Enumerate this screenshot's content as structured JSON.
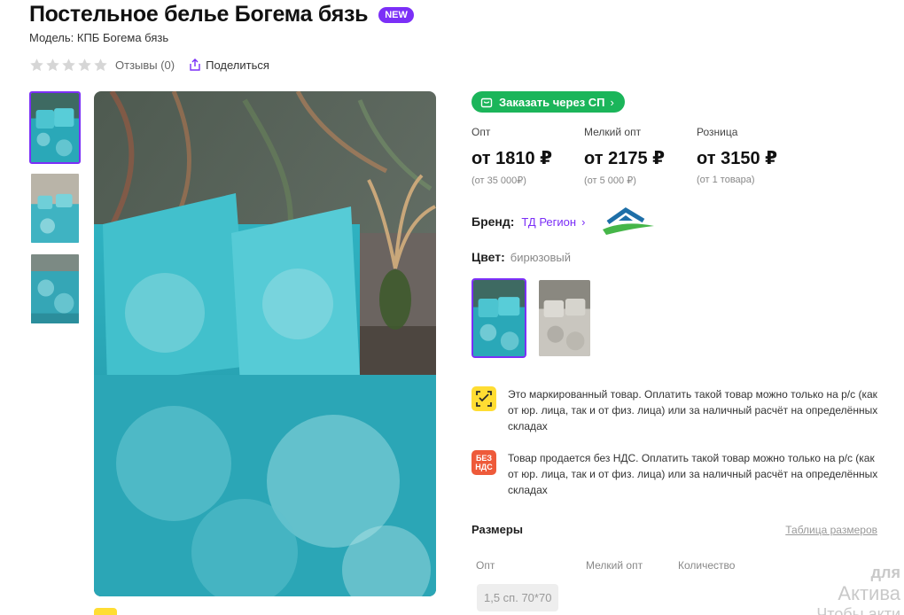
{
  "product": {
    "title": "Постельное белье Богема бязь",
    "badge": "NEW",
    "model": "Модель: КПБ Богема бязь",
    "reviews": "Отзывы (0)",
    "share": "Поделиться",
    "rating_stars": 0
  },
  "order_sp": {
    "label": "Заказать через СП",
    "chevron": "›"
  },
  "prices": [
    {
      "label": "Опт",
      "value": "от 1810 ₽",
      "min": "(от 35 000₽)"
    },
    {
      "label": "Мелкий опт",
      "value": "от 2175 ₽",
      "min": "(от 5 000 ₽)"
    },
    {
      "label": "Розница",
      "value": "от 3150 ₽",
      "min": "(от 1 товара)"
    }
  ],
  "brand": {
    "label": "Бренд:",
    "name": "ТД Регион",
    "chevron": "›"
  },
  "color": {
    "label": "Цвет:",
    "value": "бирюзовый"
  },
  "notices": [
    {
      "icon": "marking-icon",
      "text": "Это маркированный товар. Оплатить такой товар можно только на р/с (как от юр. лица, так и от физ. лица) или за наличный расчёт на определённых складах"
    },
    {
      "icon": "no-vat-icon",
      "icon_text": "БЕЗ НДС",
      "text": "Товар продается без НДС. Оплатить такой товар можно только на р/с (как от юр. лица, так и от физ. лица) или за наличный расчёт на определённых складах"
    }
  ],
  "sizes": {
    "title": "Размеры",
    "table_link": "Таблица размеров",
    "columns": [
      "Опт",
      "Мелкий опт",
      "Количество"
    ],
    "items": [
      "1,5 сп. 70*70"
    ]
  },
  "watermark": {
    "line1": "для",
    "line2": "Актива",
    "line3": "Чтобы акти"
  },
  "colors": {
    "accent": "#7b2ff7",
    "green": "#1bb55a",
    "marking_bg": "#ffdd33",
    "novat_bg": "#ee5a3a"
  }
}
